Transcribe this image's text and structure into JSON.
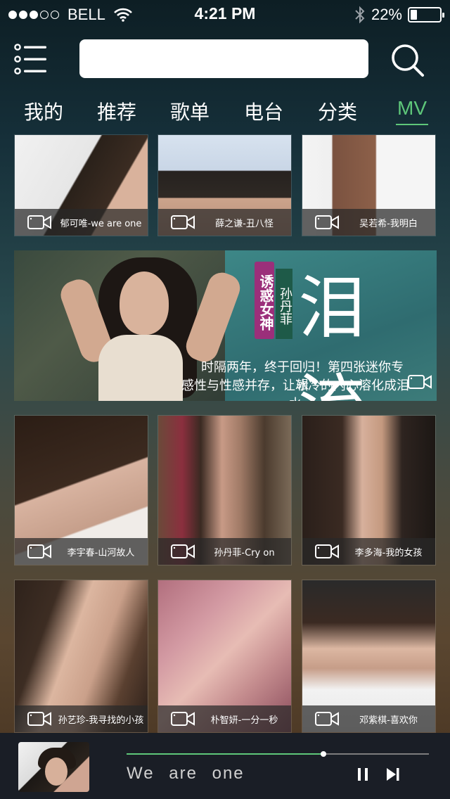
{
  "status_bar": {
    "carrier": "BELL",
    "time": "4:21 PM",
    "battery_percent_text": "22%",
    "battery_level": 0.22,
    "signal_bars": 2,
    "signal_total": 5
  },
  "search": {
    "placeholder": ""
  },
  "tabs": [
    {
      "label": "我的",
      "active": false
    },
    {
      "label": "推荐",
      "active": false
    },
    {
      "label": "歌单",
      "active": false
    },
    {
      "label": "电台",
      "active": false
    },
    {
      "label": "分类",
      "active": false
    },
    {
      "label": "MV",
      "active": true
    }
  ],
  "grid_top": [
    {
      "title": "郁可唯-we are one",
      "icon": "video-camera-icon"
    },
    {
      "title": "薛之谦-丑八怪",
      "icon": "video-camera-icon"
    },
    {
      "title": "吴若希-我明白",
      "icon": "video-camera-icon"
    }
  ],
  "banner": {
    "tag_pink": "诱惑女神",
    "tag_green": "孙丹菲",
    "big_title": "泪流",
    "line1": "时隔两年，终于回归！第四张迷你专辑",
    "line2": "感性与性感并存，让冰冷的内心溶化成泪水",
    "icon": "video-camera-icon"
  },
  "grid_middle": [
    {
      "title": "李宇春-山河故人",
      "icon": "video-camera-icon"
    },
    {
      "title": "孙丹菲-Cry on",
      "icon": "video-camera-icon"
    },
    {
      "title": "李多海-我的女孩",
      "icon": "video-camera-icon"
    }
  ],
  "grid_bottom": [
    {
      "title": "孙艺珍-我寻找的小孩",
      "icon": "video-camera-icon"
    },
    {
      "title": "朴智妍-一分一秒",
      "icon": "video-camera-icon"
    },
    {
      "title": "邓紫棋-喜欢你",
      "icon": "video-camera-icon"
    }
  ],
  "player": {
    "song": "We are one",
    "progress": 0.65,
    "accent": "#5ec77a"
  },
  "colors": {
    "accent": "#5ec77a",
    "caption_bg": "rgba(40,40,40,0.72)",
    "player_bg": "#1a1e26"
  }
}
